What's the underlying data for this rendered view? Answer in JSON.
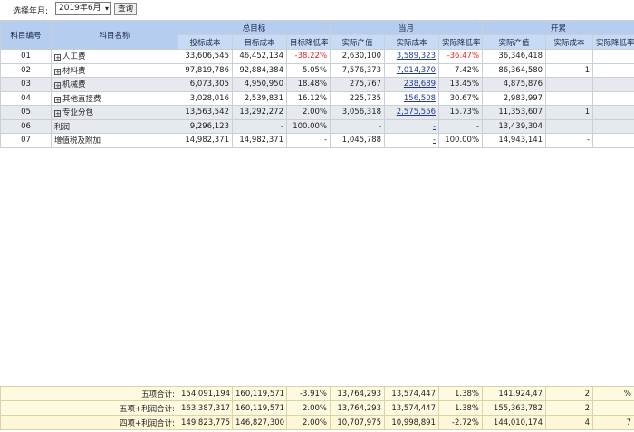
{
  "toolbar": {
    "select_label": "选择年月:",
    "period_value": "2019年6月",
    "query_button": "查询"
  },
  "headers": {
    "code": "科目编号",
    "name": "科目名称",
    "group_total": "总目标",
    "group_month": "当月",
    "group_cumulative": "开累",
    "bid_cost": "投标成本",
    "target_cost": "目标成本",
    "target_reduction": "目标降低率",
    "actual_output": "实际产值",
    "actual_cost": "实际成本",
    "actual_reduction": "实际降低率"
  },
  "rows": [
    {
      "code": "01",
      "name": "人工费",
      "expandable": true,
      "bid": "33,606,545",
      "target": "46,452,134",
      "target_rate": "-38.22%",
      "target_rate_neg": true,
      "m_output": "2,630,100",
      "m_cost": "3,589,323",
      "m_cost_link": true,
      "m_rate": "-36.47%",
      "m_rate_neg": true,
      "c_output": "36,346,418",
      "c_cost": "",
      "c_rate": ""
    },
    {
      "code": "02",
      "name": "材料费",
      "expandable": true,
      "bid": "97,819,786",
      "target": "92,884,384",
      "target_rate": "5.05%",
      "target_rate_neg": false,
      "m_output": "7,576,373",
      "m_cost": "7,014,370",
      "m_cost_link": true,
      "m_rate": "7.42%",
      "m_rate_neg": false,
      "c_output": "86,364,580",
      "c_cost": "1",
      "c_rate": ""
    },
    {
      "code": "03",
      "name": "机械费",
      "expandable": true,
      "bid": "6,073,305",
      "target": "4,950,950",
      "target_rate": "18.48%",
      "target_rate_neg": false,
      "m_output": "275,767",
      "m_cost": "238,689",
      "m_cost_link": true,
      "m_rate": "13.45%",
      "m_rate_neg": false,
      "c_output": "4,875,876",
      "c_cost": "",
      "c_rate": ""
    },
    {
      "code": "04",
      "name": "其他直接费",
      "expandable": true,
      "bid": "3,028,016",
      "target": "2,539,831",
      "target_rate": "16.12%",
      "target_rate_neg": false,
      "m_output": "225,735",
      "m_cost": "156,508",
      "m_cost_link": true,
      "m_rate": "30.67%",
      "m_rate_neg": false,
      "c_output": "2,983,997",
      "c_cost": "",
      "c_rate": ""
    },
    {
      "code": "05",
      "name": "专业分包",
      "expandable": true,
      "bid": "13,563,542",
      "target": "13,292,272",
      "target_rate": "2.00%",
      "target_rate_neg": false,
      "m_output": "3,056,318",
      "m_cost": "2,575,556",
      "m_cost_link": true,
      "m_rate": "15.73%",
      "m_rate_neg": false,
      "c_output": "11,353,607",
      "c_cost": "1",
      "c_rate": ""
    },
    {
      "code": "06",
      "name": "利润",
      "expandable": false,
      "bid": "9,296,123",
      "target": "-",
      "target_rate": "100.00%",
      "target_rate_neg": false,
      "m_output": "-",
      "m_cost": "-",
      "m_cost_link": true,
      "m_rate": "-",
      "m_rate_neg": false,
      "c_output": "13,439,304",
      "c_cost": "",
      "c_rate": ""
    },
    {
      "code": "07",
      "name": "增值税及附加",
      "expandable": false,
      "bid": "14,982,371",
      "target": "14,982,371",
      "target_rate": "-",
      "target_rate_neg": false,
      "m_output": "1,045,788",
      "m_cost": "-",
      "m_cost_link": true,
      "m_rate": "100.00%",
      "m_rate_neg": false,
      "c_output": "14,943,141",
      "c_cost": "-",
      "c_rate": ""
    }
  ],
  "summary": [
    {
      "label": "五项合计:",
      "bid": "154,091,194",
      "target": "160,119,571",
      "target_rate": "-3.91%",
      "m_output": "13,764,293",
      "m_cost": "13,574,447",
      "m_rate": "1.38%",
      "c_output": "141,924,47",
      "c_cost": "2",
      "c_rate": "%"
    },
    {
      "label": "五项+利润合计:",
      "bid": "163,387,317",
      "target": "160,119,571",
      "target_rate": "2.00%",
      "m_output": "13,764,293",
      "m_cost": "13,574,447",
      "m_rate": "1.38%",
      "c_output": "155,363,782",
      "c_cost": "2",
      "c_rate": ""
    },
    {
      "label": "四项+利润合计:",
      "bid": "149,823,775",
      "target": "146,827,300",
      "target_rate": "2.00%",
      "m_output": "10,707,975",
      "m_cost": "10,998,891",
      "m_rate": "-2.72%",
      "c_output": "144,010,174",
      "c_cost": "4",
      "c_rate": "7"
    }
  ]
}
